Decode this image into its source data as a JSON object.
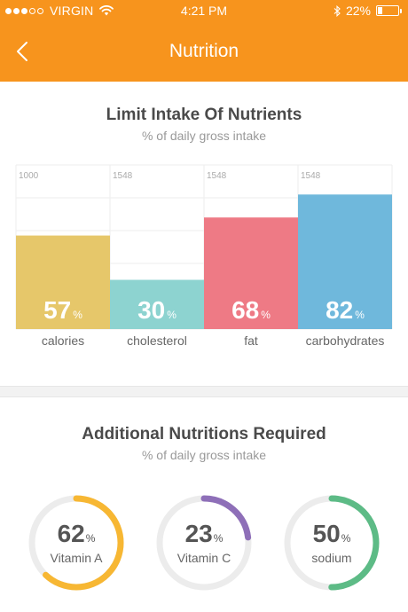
{
  "status_bar": {
    "carrier": "VIRGIN",
    "time": "4:21 PM",
    "battery": "22%",
    "battery_level": 0.22,
    "signal_dots": [
      true,
      true,
      true,
      false,
      false
    ]
  },
  "nav": {
    "title": "Nutrition",
    "back_icon": "chevron-left-icon"
  },
  "limit_section": {
    "title": "Limit Intake Of Nutrients",
    "subtitle": "% of daily gross intake"
  },
  "chart_data": {
    "type": "bar",
    "categories": [
      "calories",
      "cholesterol",
      "fat",
      "carbohydrates"
    ],
    "values": [
      57,
      30,
      68,
      82
    ],
    "value_suffix": "%",
    "column_headers": [
      "1000",
      "1548",
      "1548",
      "1548"
    ],
    "ylim": [
      0,
      100
    ],
    "grid": true,
    "colors": [
      "#e6c76a",
      "#8dd3d0",
      "#ee7a85",
      "#6fb8dc"
    ]
  },
  "additional_section": {
    "title": "Additional Nutritions Required",
    "subtitle": "% of daily gross intake",
    "rings": [
      {
        "label": "Vitamin A",
        "value": "62",
        "suffix": "%",
        "fraction": 0.62,
        "color": "#f7b733"
      },
      {
        "label": "Vitamin C",
        "value": "23",
        "suffix": "%",
        "fraction": 0.23,
        "color": "#8e6fb8"
      },
      {
        "label": "sodium",
        "value": "50",
        "suffix": "%",
        "fraction": 0.5,
        "color": "#5dbb86"
      }
    ],
    "track_color": "#ececec"
  },
  "theme": {
    "accent": "#f7941d"
  }
}
